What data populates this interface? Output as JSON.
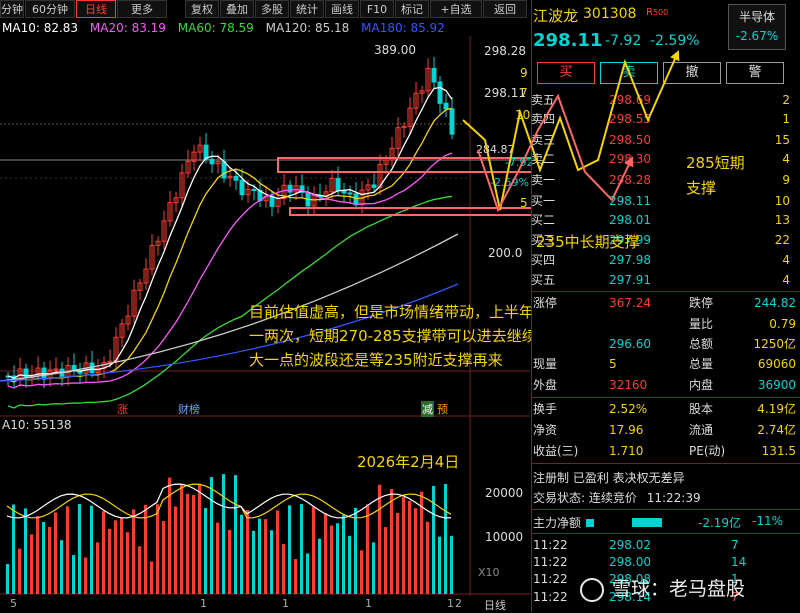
{
  "toolbar": {
    "tabs": [
      "分钟",
      "60分钟",
      "日线",
      "更多"
    ],
    "active_tab": "日线",
    "tools": [
      "复权",
      "叠加",
      "多股",
      "统计",
      "画线",
      "F10",
      "标记",
      "+自选",
      "返回"
    ]
  },
  "ma_legend": [
    {
      "label": "MA10: 82.83",
      "color": "#ffffff"
    },
    {
      "label": "MA20: 83.19",
      "color": "#ff55ff"
    },
    {
      "label": "MA60: 78.59",
      "color": "#33dd33"
    },
    {
      "label": "MA120: 85.18",
      "color": "#cccccc"
    },
    {
      "label": "MA180: 85.92",
      "color": "#3355ff"
    }
  ],
  "chart_data": {
    "type": "candlestick",
    "y_ticks": [
      "298.28",
      "298.11",
      "284.87",
      "200.0"
    ],
    "peak_label": "389.00",
    "right_percent_ticks": [
      "9",
      "7",
      "10",
      "5",
      "5",
      "1"
    ],
    "right_percent_labels": [
      "-2.59%",
      "-7.92"
    ],
    "event_markers": [
      "涨",
      "财榜",
      "减",
      "预"
    ],
    "volume_legend": "A10: 55138",
    "volume_ticks": [
      "20000",
      "10000"
    ],
    "volume_unit": "X10",
    "x_ticks": [
      "5",
      "",
      "1",
      "",
      "1",
      "",
      "1",
      "",
      "1",
      "2"
    ],
    "x_axis_end_label": "日线"
  },
  "annotations": {
    "main_text_line1": "目前估值虚高，但是市场情绪带动，上半年翻炒机会还有",
    "main_text_line2": "一两次，短期270-285支撑带可以进去继续喝汤",
    "main_text_line3": "大一点的波段还是等235附近支撑再来",
    "support_short": "285短期",
    "support_short2": "支撑",
    "support_long": "235中长期支撑",
    "date": "2026年2月4日"
  },
  "stock": {
    "name": "江波龙",
    "code": "301308",
    "badge": "R",
    "badge_sub": "500",
    "sector": "半导体",
    "sector_change": "-2.67%",
    "price": "298.11",
    "change": "-7.92",
    "change_pct": "-2.59%",
    "actions": [
      "买",
      "卖",
      "撤",
      "警"
    ]
  },
  "order_book": {
    "asks": [
      {
        "label": "卖五",
        "price": "298.69",
        "vol": "2"
      },
      {
        "label": "卖四",
        "price": "298.55",
        "vol": "1"
      },
      {
        "label": "卖三",
        "price": "298.50",
        "vol": "15"
      },
      {
        "label": "卖二",
        "price": "298.30",
        "vol": "4"
      },
      {
        "label": "卖一",
        "price": "298.28",
        "vol": "9"
      }
    ],
    "bids": [
      {
        "label": "买一",
        "price": "298.11",
        "vol": "10"
      },
      {
        "label": "买二",
        "price": "298.01",
        "vol": "13"
      },
      {
        "label": "买三",
        "price": "297.99",
        "vol": "22"
      },
      {
        "label": "买四",
        "price": "297.98",
        "vol": "4"
      },
      {
        "label": "买五",
        "price": "297.91",
        "vol": "4"
      }
    ]
  },
  "stats": [
    {
      "l1": "涨停",
      "v1": "367.24",
      "l2": "跌停",
      "v2": "244.82"
    },
    {
      "l1": "",
      "v1": "",
      "l2": "量比",
      "v2": "0.79"
    },
    {
      "l1": "",
      "v1": "296.60",
      "l2": "总额",
      "v2": "1250亿"
    },
    {
      "l1": "现量",
      "v1": "5",
      "l2": "总量",
      "v2": "69060"
    },
    {
      "l1": "外盘",
      "v1": "32160",
      "l2": "内盘",
      "v2": "36900"
    },
    {
      "l1": "换手",
      "v1": "2.52%",
      "l2": "股本",
      "v2": "4.19亿"
    },
    {
      "l1": "净资",
      "v1": "17.96",
      "l2": "流通",
      "v2": "2.74亿"
    },
    {
      "l1": "收益(三)",
      "v1": "1.710",
      "l2": "PE(动)",
      "v2": "131.5"
    }
  ],
  "status": {
    "registration": "注册制 已盈利 表决权无差异",
    "trade_state_label": "交易状态:",
    "trade_state": "连续竞价",
    "trade_time": "11:22:39",
    "main_flow_label": "主力净额",
    "main_flow_value": "-2.19亿",
    "main_flow_pct": "-11%"
  },
  "ticks": [
    {
      "time": "11:22",
      "price": "298.02",
      "vol": "7"
    },
    {
      "time": "11:22",
      "price": "298.00",
      "vol": "14"
    },
    {
      "time": "11:22",
      "price": "298.08",
      "vol": "1"
    },
    {
      "time": "11:22",
      "price": "298.14",
      "vol": "7"
    }
  ],
  "watermark": "雪球：老马盘股",
  "colors": {
    "up": "#ff3b30",
    "down": "#00d4d4",
    "annotation_yellow": "#f5d400",
    "box_red": "#ff6666"
  }
}
